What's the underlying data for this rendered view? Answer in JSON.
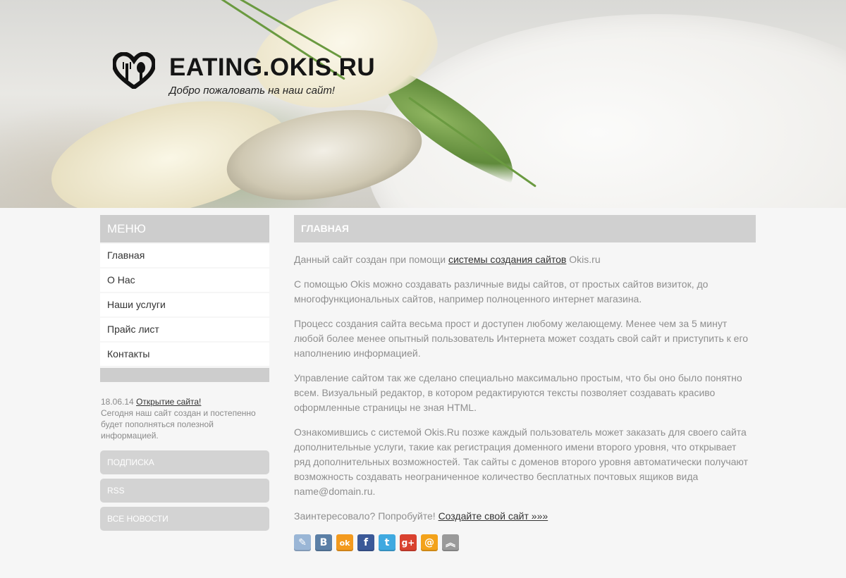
{
  "header": {
    "title": "EATING.OKIS.RU",
    "subtitle": "Добро пожаловать на наш сайт!"
  },
  "sidebar": {
    "menu_title": "МЕНЮ",
    "items": [
      {
        "label": "Главная"
      },
      {
        "label": "О Нас"
      },
      {
        "label": "Наши услуги"
      },
      {
        "label": "Прайс лист"
      },
      {
        "label": "Контакты"
      }
    ],
    "news": {
      "date": "18.06.14",
      "link": "Открытие сайта!",
      "text": "Сегодня наш сайт создан и постепенно будет пополняться полезной информацией."
    },
    "buttons": [
      {
        "label": "ПОДПИСКА"
      },
      {
        "label": "RSS"
      },
      {
        "label": "ВСЕ НОВОСТИ"
      }
    ]
  },
  "main": {
    "heading": "ГЛАВНАЯ",
    "p1_before": "Данный сайт создан при помощи ",
    "p1_link": "системы создания сайтов",
    "p1_after": " Okis.ru",
    "p2": "С помощью Okis можно создавать различные виды сайтов, от простых сайтов визиток, до многофункциональных сайтов, например полноценного интернет магазина.",
    "p3": "Процесс создания сайта весьма прост и доступен любому желающему. Менее чем за 5 минут любой более менее опытный пользователь Интернета может создать свой сайт и приступить к его наполнению информацией.",
    "p4": "Управление сайтом так же сделано специально максимально простым, что бы оно было понятно всем. Визуальный редактор, в котором редактируются тексты позволяет создавать красиво оформленные страницы не зная HTML.",
    "p5": "Ознакомившись с системой Okis.Ru позже каждый пользователь может заказать для своего сайта дополнительные услуги, такие как регистрация доменного имени второго уровня, что открывает ряд дополнительных возможностей. Так сайты с доменов второго уровня автоматически получают возможность создавать неограниченное количество бесплатных почтовых ящиков вида name@domain.ru.",
    "p6_before": "Заинтересовало? Попробуйте! ",
    "p6_link": "Создайте свой сайт »»»"
  },
  "share": [
    {
      "icon": "livejournal-icon",
      "glyph": "✎",
      "color": "#9ab6d6"
    },
    {
      "icon": "vkontakte-icon",
      "glyph": "В",
      "color": "#5b7fa6"
    },
    {
      "icon": "odnoklassniki-icon",
      "glyph": "ok",
      "color": "#f39a1e"
    },
    {
      "icon": "facebook-icon",
      "glyph": "f",
      "color": "#3b5998"
    },
    {
      "icon": "twitter-icon",
      "glyph": "t",
      "color": "#3fa9e0"
    },
    {
      "icon": "google-plus-icon",
      "glyph": "g+",
      "color": "#d9412f"
    },
    {
      "icon": "mailru-icon",
      "glyph": "@",
      "color": "#f3a21a"
    },
    {
      "icon": "more-icon",
      "glyph": "︽",
      "color": "#9a9a9a"
    }
  ]
}
